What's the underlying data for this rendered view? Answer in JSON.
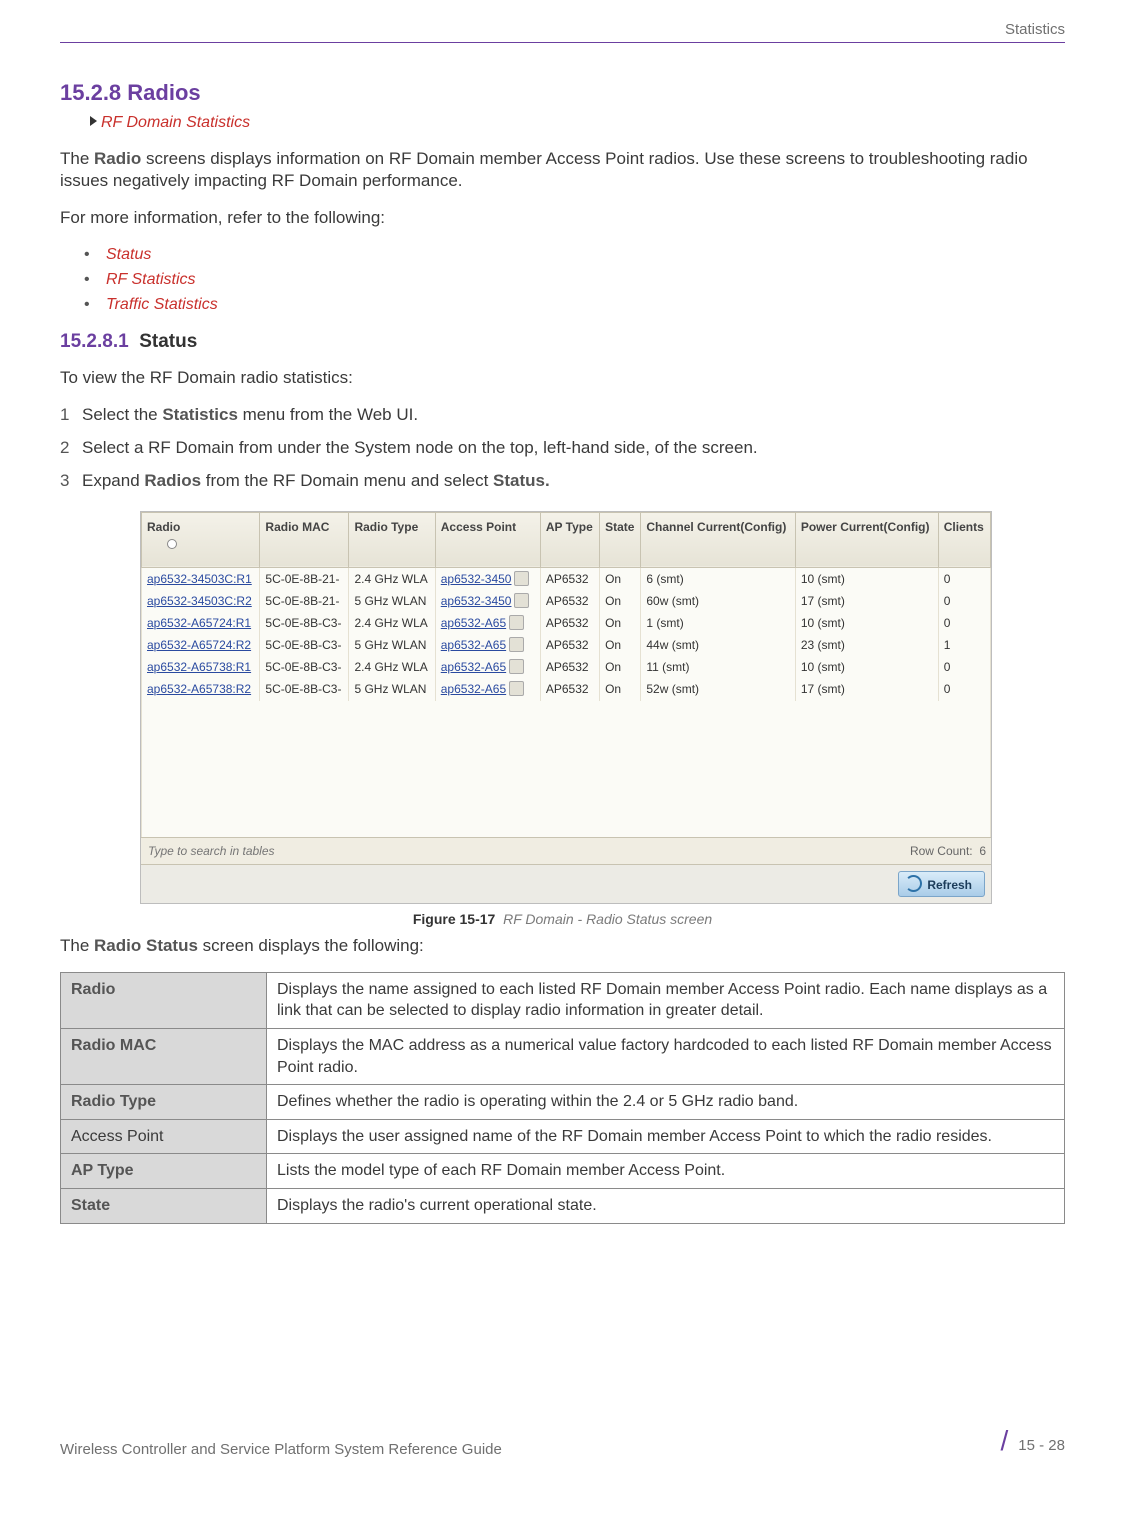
{
  "header": {
    "section": "Statistics"
  },
  "heading": {
    "number": "15.2.8",
    "title": "Radios"
  },
  "breadcrumb": "RF Domain Statistics",
  "intro_part_a": "The ",
  "intro_bold": "Radio",
  "intro_part_b": " screens displays information on RF Domain member Access Point radios. Use these screens to troubleshooting radio issues negatively impacting RF Domain performance.",
  "moreinfo_lead": "For more information, refer to the following:",
  "links": [
    "Status",
    "RF Statistics",
    "Traffic Statistics"
  ],
  "sub": {
    "number": "15.2.8.1",
    "title": "Status"
  },
  "stat_intro": "To view the RF Domain radio statistics:",
  "steps": [
    {
      "n": "1",
      "pre": "Select the ",
      "b": "Statistics",
      "post": " menu from the Web UI."
    },
    {
      "n": "2",
      "pre": "Select a RF Domain from under the System node on the top, left-hand side, of the screen.",
      "b": "",
      "post": ""
    },
    {
      "n": "3",
      "pre": "Expand ",
      "b": "Radios",
      "mid": " from the RF Domain menu and select ",
      "b2": "Status.",
      "post": ""
    }
  ],
  "table": {
    "headers": [
      "Radio",
      "Radio MAC",
      "Radio Type",
      "Access Point",
      "AP Type",
      "State",
      "Channel Current(Config)",
      "Power Current(Config)",
      "Clients"
    ],
    "rows": [
      {
        "radio": "ap6532-34503C:R1",
        "mac": "5C-0E-8B-21-",
        "type": "2.4 GHz WLA",
        "ap": "ap6532-3450",
        "aptype": "AP6532",
        "state": "On",
        "chan": "6 (smt)",
        "pow": "10 (smt)",
        "cli": "0"
      },
      {
        "radio": "ap6532-34503C:R2",
        "mac": "5C-0E-8B-21-",
        "type": "5 GHz WLAN",
        "ap": "ap6532-3450",
        "aptype": "AP6532",
        "state": "On",
        "chan": "60w (smt)",
        "pow": "17 (smt)",
        "cli": "0"
      },
      {
        "radio": "ap6532-A65724:R1",
        "mac": "5C-0E-8B-C3-",
        "type": "2.4 GHz WLA",
        "ap": "ap6532-A65",
        "aptype": "AP6532",
        "state": "On",
        "chan": "1 (smt)",
        "pow": "10 (smt)",
        "cli": "0"
      },
      {
        "radio": "ap6532-A65724:R2",
        "mac": "5C-0E-8B-C3-",
        "type": "5 GHz WLAN",
        "ap": "ap6532-A65",
        "aptype": "AP6532",
        "state": "On",
        "chan": "44w (smt)",
        "pow": "23 (smt)",
        "cli": "1"
      },
      {
        "radio": "ap6532-A65738:R1",
        "mac": "5C-0E-8B-C3-",
        "type": "2.4 GHz WLA",
        "ap": "ap6532-A65",
        "aptype": "AP6532",
        "state": "On",
        "chan": "11 (smt)",
        "pow": "10 (smt)",
        "cli": "0"
      },
      {
        "radio": "ap6532-A65738:R2",
        "mac": "5C-0E-8B-C3-",
        "type": "5 GHz WLAN",
        "ap": "ap6532-A65",
        "aptype": "AP6532",
        "state": "On",
        "chan": "52w (smt)",
        "pow": "17 (smt)",
        "cli": "0"
      }
    ],
    "search_placeholder": "Type to search in tables",
    "rowcount_label": "Row Count:",
    "rowcount_value": "6",
    "refresh": "Refresh"
  },
  "figure": {
    "label": "Figure 15-17",
    "caption": "RF Domain - Radio Status screen"
  },
  "after_fig_a": "The ",
  "after_fig_b": "Radio Status",
  "after_fig_c": " screen displays the following:",
  "desc": [
    {
      "k": "Radio",
      "v": "Displays the name assigned to each listed RF Domain member Access Point radio. Each name displays as a link that can be selected to display radio information in greater detail.",
      "plain": false
    },
    {
      "k": "Radio MAC",
      "v": "Displays the MAC address as a numerical value factory hardcoded to each listed RF Domain member Access Point radio.",
      "plain": false
    },
    {
      "k": "Radio Type",
      "v": "Defines whether the radio is operating within the 2.4 or 5 GHz radio band.",
      "plain": false
    },
    {
      "k": "Access Point",
      "v": "Displays the user assigned name of the RF Domain member Access Point to which the radio resides.",
      "plain": true
    },
    {
      "k": "AP Type",
      "v": "Lists the model type of each RF Domain member Access Point.",
      "plain": false
    },
    {
      "k": "State",
      "v": "Displays the radio's current operational state.",
      "plain": false
    }
  ],
  "footer": {
    "left": "Wireless Controller and Service Platform System Reference Guide",
    "right": "15 - 28"
  }
}
